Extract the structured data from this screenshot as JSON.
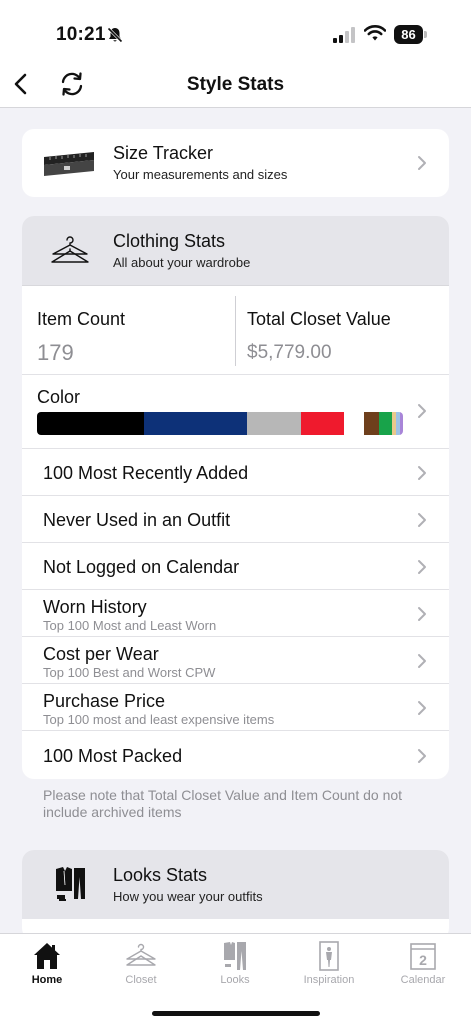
{
  "status_bar": {
    "time": "10:21",
    "battery": "86"
  },
  "nav": {
    "title": "Style Stats"
  },
  "size_tracker": {
    "title": "Size Tracker",
    "subtitle": "Your measurements and sizes"
  },
  "clothing_stats": {
    "title": "Clothing Stats",
    "subtitle": "All about your wardrobe",
    "item_count_label": "Item Count",
    "item_count_value": "179",
    "closet_value_label": "Total Closet Value",
    "closet_value_value": "$5,779.00",
    "color_label": "Color",
    "color_segments": [
      {
        "color": "#000000",
        "share": 0.29
      },
      {
        "color": "#0d3178",
        "share": 0.28
      },
      {
        "color": "#b7b7b7",
        "share": 0.145
      },
      {
        "color": "#ef1a2d",
        "share": 0.118
      },
      {
        "color": "#ffffff",
        "share": 0.055
      },
      {
        "color": "#6e3f1c",
        "share": 0.04
      },
      {
        "color": "#18a34a",
        "share": 0.035
      },
      {
        "color": "#e9c98c",
        "share": 0.012
      },
      {
        "color": "#9ec2e6",
        "share": 0.01
      },
      {
        "color": "#a885d8",
        "share": 0.008
      }
    ],
    "rows": [
      {
        "label": "100 Most Recently Added",
        "subtitle": ""
      },
      {
        "label": "Never Used in an Outfit",
        "subtitle": ""
      },
      {
        "label": "Not Logged on Calendar",
        "subtitle": ""
      },
      {
        "label": "Worn History",
        "subtitle": "Top 100 Most and Least Worn"
      },
      {
        "label": "Cost per Wear",
        "subtitle": "Top 100 Best and Worst CPW"
      },
      {
        "label": "Purchase Price",
        "subtitle": "Top 100 most and least expensive items"
      },
      {
        "label": "100 Most Packed",
        "subtitle": ""
      }
    ],
    "note": "Please note that Total Closet Value and Item Count do not include archived items"
  },
  "looks_stats": {
    "title": "Looks Stats",
    "subtitle": "How you wear your outfits"
  },
  "tabs": [
    {
      "label": "Home",
      "icon": "home-icon",
      "active": true
    },
    {
      "label": "Closet",
      "icon": "hanger-icon",
      "active": false
    },
    {
      "label": "Looks",
      "icon": "outfit-icon",
      "active": false
    },
    {
      "label": "Inspiration",
      "icon": "inspiration-icon",
      "active": false
    },
    {
      "label": "Calendar",
      "icon": "calendar-icon",
      "active": false
    }
  ],
  "calendar_icon_day": "2"
}
